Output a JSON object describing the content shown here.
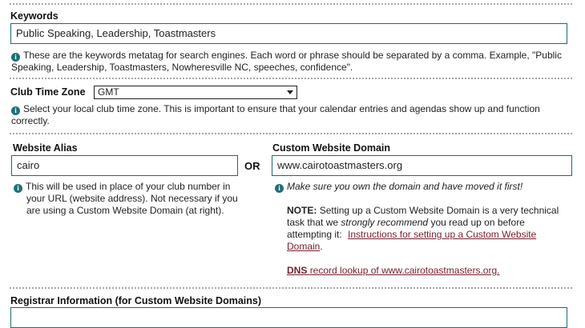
{
  "keywords": {
    "label": "Keywords",
    "value": "Public Speaking, Leadership, Toastmasters",
    "help": "These are the keywords metatag for search engines. Each word or phrase should be separated by a comma. Example, \"Public Speaking, Leadership, Toastmasters, Nowheresville NC, speeches, confidence\"."
  },
  "timezone": {
    "label": "Club Time Zone",
    "selected": "GMT",
    "help": "Select your local club time zone. This is important to ensure that your calendar entries and agendas show up and function correctly."
  },
  "alias": {
    "label": "Website Alias",
    "value": "cairo",
    "help": "This will be used in place of your club number in your URL (website address). Not necessary if you are using a Custom Website Domain (at right)."
  },
  "or_label": "OR",
  "domain": {
    "label": "Custom Website Domain",
    "value": "www.cairotoastmasters.org",
    "help": "Make sure you own the domain and have moved it first!",
    "note_label": "NOTE:",
    "note_text_1": "Setting up a Custom Website Domain is a very technical task that we",
    "note_emphasis": "strongly recommend",
    "note_text_2": "you read up on before attempting it:",
    "instructions_link": "Instructions for setting up a Custom Website Domain",
    "note_end": ".",
    "dns_prefix": "DNS",
    "dns_link": "record lookup of www.cairotoastmasters.org."
  },
  "registrar": {
    "label": "Registrar Information (for Custom Website Domains)"
  },
  "colors": {
    "accent": "#1f6f78",
    "link": "#7a2030",
    "separator": "#a8a8a8"
  }
}
